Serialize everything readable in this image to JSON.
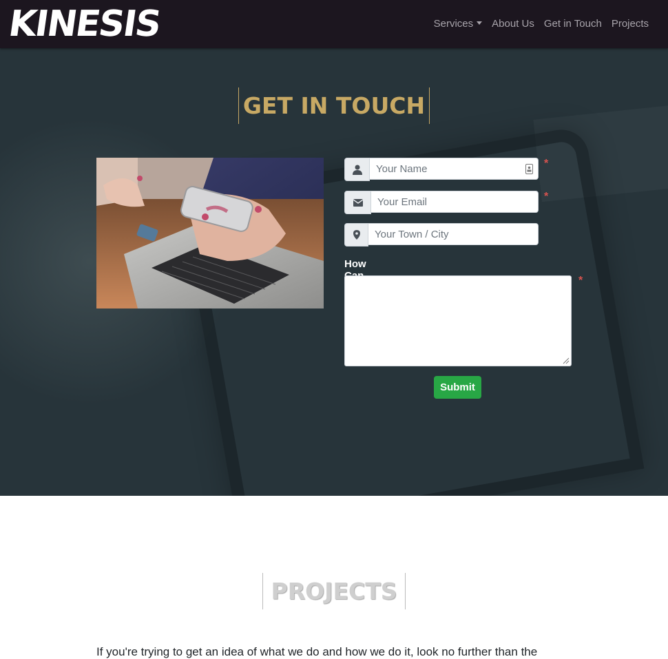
{
  "nav": {
    "brand": "KINESIS",
    "items": [
      {
        "label": "Services"
      },
      {
        "label": "About Us"
      },
      {
        "label": "Get in Touch"
      },
      {
        "label": "Projects"
      }
    ]
  },
  "contact": {
    "heading": "GET IN TOUCH",
    "form": {
      "name_placeholder": "Your Name",
      "email_placeholder": "Your Email",
      "city_placeholder": "Your Town / City",
      "help_label": "How Can We Help?",
      "required_mark": "*",
      "submit_label": "Submit"
    }
  },
  "projects": {
    "heading": "PROJECTS",
    "intro": "If you're trying to get an idea of what we do and how we do it, look no further than the"
  }
}
